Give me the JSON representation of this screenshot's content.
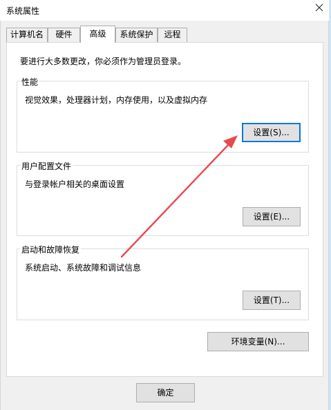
{
  "window": {
    "title": "系统属性"
  },
  "tabs": [
    {
      "label": "计算机名"
    },
    {
      "label": "硬件"
    },
    {
      "label": "高级"
    },
    {
      "label": "系统保护"
    },
    {
      "label": "远程"
    }
  ],
  "notice": "要进行大多数更改，你必须作为管理员登录。",
  "performance": {
    "title": "性能",
    "description": "视觉效果，处理器计划，内存使用，以及虚拟内存",
    "button": "设置(S)..."
  },
  "user_profiles": {
    "title": "用户配置文件",
    "description": "与登录帐户相关的桌面设置",
    "button": "设置(E)..."
  },
  "startup_recovery": {
    "title": "启动和故障恢复",
    "description": "系统启动、系统故障和调试信息",
    "button": "设置(T)..."
  },
  "env_button": "环境变量(N)...",
  "ok_button": "确定",
  "colors": {
    "focus_border": "#0078d7",
    "annotation_arrow": "#e8494b"
  },
  "icons": {
    "close": "close-icon"
  }
}
